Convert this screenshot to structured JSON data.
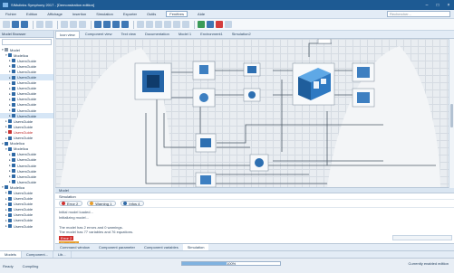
{
  "window": {
    "title": "SIMulinks Symphony 2017 - [Demonstration edition]",
    "minimize": "–",
    "maximize": "□",
    "close": "×"
  },
  "menu": {
    "items": [
      "Fichier",
      "Edition",
      "Affichage",
      "Insertion",
      "Simulation",
      "Exporter",
      "Outils",
      "Fenêtres",
      "Aide"
    ],
    "active_index": 7,
    "search_placeholder": "Rechercher..."
  },
  "toolbar": {
    "icons": [
      "new-icon",
      "open-icon",
      "save-icon",
      "undo-icon",
      "redo-icon",
      "cut-icon",
      "copy-icon",
      "paste-icon",
      "zoom-in-icon",
      "zoom-out-icon",
      "zoom-fit-icon",
      "info-icon",
      "select-icon",
      "line-icon",
      "rect-icon",
      "ellipse-icon",
      "text-icon",
      "grid-icon",
      "run-icon",
      "pause-icon",
      "stop-icon",
      "settings-icon"
    ]
  },
  "sidebar": {
    "header": "Model Browser",
    "tree": [
      {
        "label": "Model",
        "level": 0,
        "icon": "folder",
        "expanded": true
      },
      {
        "label": "Modelica",
        "level": 1,
        "icon": "package",
        "expanded": true
      },
      {
        "label": "UsersGuide",
        "level": 2,
        "icon": "doc"
      },
      {
        "label": "UsersGuide",
        "level": 2,
        "icon": "doc"
      },
      {
        "label": "UsersGuide",
        "level": 2,
        "icon": "doc"
      },
      {
        "label": "UsersGuide",
        "level": 2,
        "icon": "doc",
        "selected": true
      },
      {
        "label": "UsersGuide",
        "level": 2,
        "icon": "doc"
      },
      {
        "label": "UsersGuide",
        "level": 2,
        "icon": "doc"
      },
      {
        "label": "UsersGuide",
        "level": 2,
        "icon": "doc"
      },
      {
        "label": "UsersGuide",
        "level": 2,
        "icon": "doc"
      },
      {
        "label": "UsersGuide",
        "level": 2,
        "icon": "doc"
      },
      {
        "label": "UsersGuide",
        "level": 2,
        "icon": "doc"
      },
      {
        "label": "UsersGuide",
        "level": 2,
        "icon": "doc",
        "selected": true
      },
      {
        "label": "UsersGuide",
        "level": 1,
        "icon": "doc"
      },
      {
        "label": "UsersGuide",
        "level": 1,
        "icon": "doc"
      },
      {
        "label": "UsersGuide",
        "level": 1,
        "icon": "error",
        "error": true
      },
      {
        "label": "UsersGuide",
        "level": 1,
        "icon": "doc"
      },
      {
        "label": "Modelica",
        "level": 0,
        "icon": "package",
        "expanded": true
      },
      {
        "label": "Modelica",
        "level": 1,
        "icon": "package",
        "expanded": true
      },
      {
        "label": "UsersGuide",
        "level": 2,
        "icon": "doc"
      },
      {
        "label": "UsersGuide",
        "level": 2,
        "icon": "doc"
      },
      {
        "label": "UsersGuide",
        "level": 2,
        "icon": "doc"
      },
      {
        "label": "UsersGuide",
        "level": 2,
        "icon": "doc"
      },
      {
        "label": "UsersGuide",
        "level": 2,
        "icon": "doc"
      },
      {
        "label": "UsersGuide",
        "level": 2,
        "icon": "doc"
      },
      {
        "label": "Modelica",
        "level": 0,
        "icon": "package",
        "expanded": true
      },
      {
        "label": "UsersGuide",
        "level": 1,
        "icon": "doc"
      },
      {
        "label": "UsersGuide",
        "level": 1,
        "icon": "doc"
      },
      {
        "label": "UsersGuide",
        "level": 1,
        "icon": "doc"
      },
      {
        "label": "UsersGuide",
        "level": 1,
        "icon": "doc"
      },
      {
        "label": "UsersGuide",
        "level": 1,
        "icon": "doc"
      },
      {
        "label": "UsersGuide",
        "level": 1,
        "icon": "doc"
      },
      {
        "label": "UsersGuide",
        "level": 1,
        "icon": "doc"
      }
    ]
  },
  "doc_tabs": {
    "items": [
      "Icon view",
      "Component view",
      "Text view",
      "Documentation",
      "Model 1",
      "Environment1",
      "Simulation2"
    ],
    "active_index": 0
  },
  "console": {
    "header": "Model",
    "title": "Simulation",
    "filters": [
      {
        "label": "Error 2",
        "color": "#d0302f"
      },
      {
        "label": "Warning 1",
        "color": "#e79d2b"
      },
      {
        "label": "Infos 4",
        "color": "#2f6aa6"
      }
    ],
    "messages": [
      "Initial model loaded...",
      "Initializing model...",
      "",
      "The model has 2 errors and 0 warnings.",
      "The model has 77 variables and 76 equations."
    ],
    "tags": [
      {
        "label": "Error 2",
        "kind": "err"
      },
      {
        "label": "Warning 1",
        "kind": "warn"
      }
    ],
    "tabs": [
      "Command window",
      "Component parameter",
      "Component variables",
      "Simulation"
    ],
    "active_tab": 3
  },
  "bottom_tabs": {
    "items": [
      "Models",
      "Component...",
      "Lib..."
    ],
    "active_index": 0
  },
  "status": {
    "left": [
      "Ready",
      "Compiling"
    ],
    "progress": 0.45,
    "zoom": "100%",
    "right": "Currently enabled edition"
  }
}
